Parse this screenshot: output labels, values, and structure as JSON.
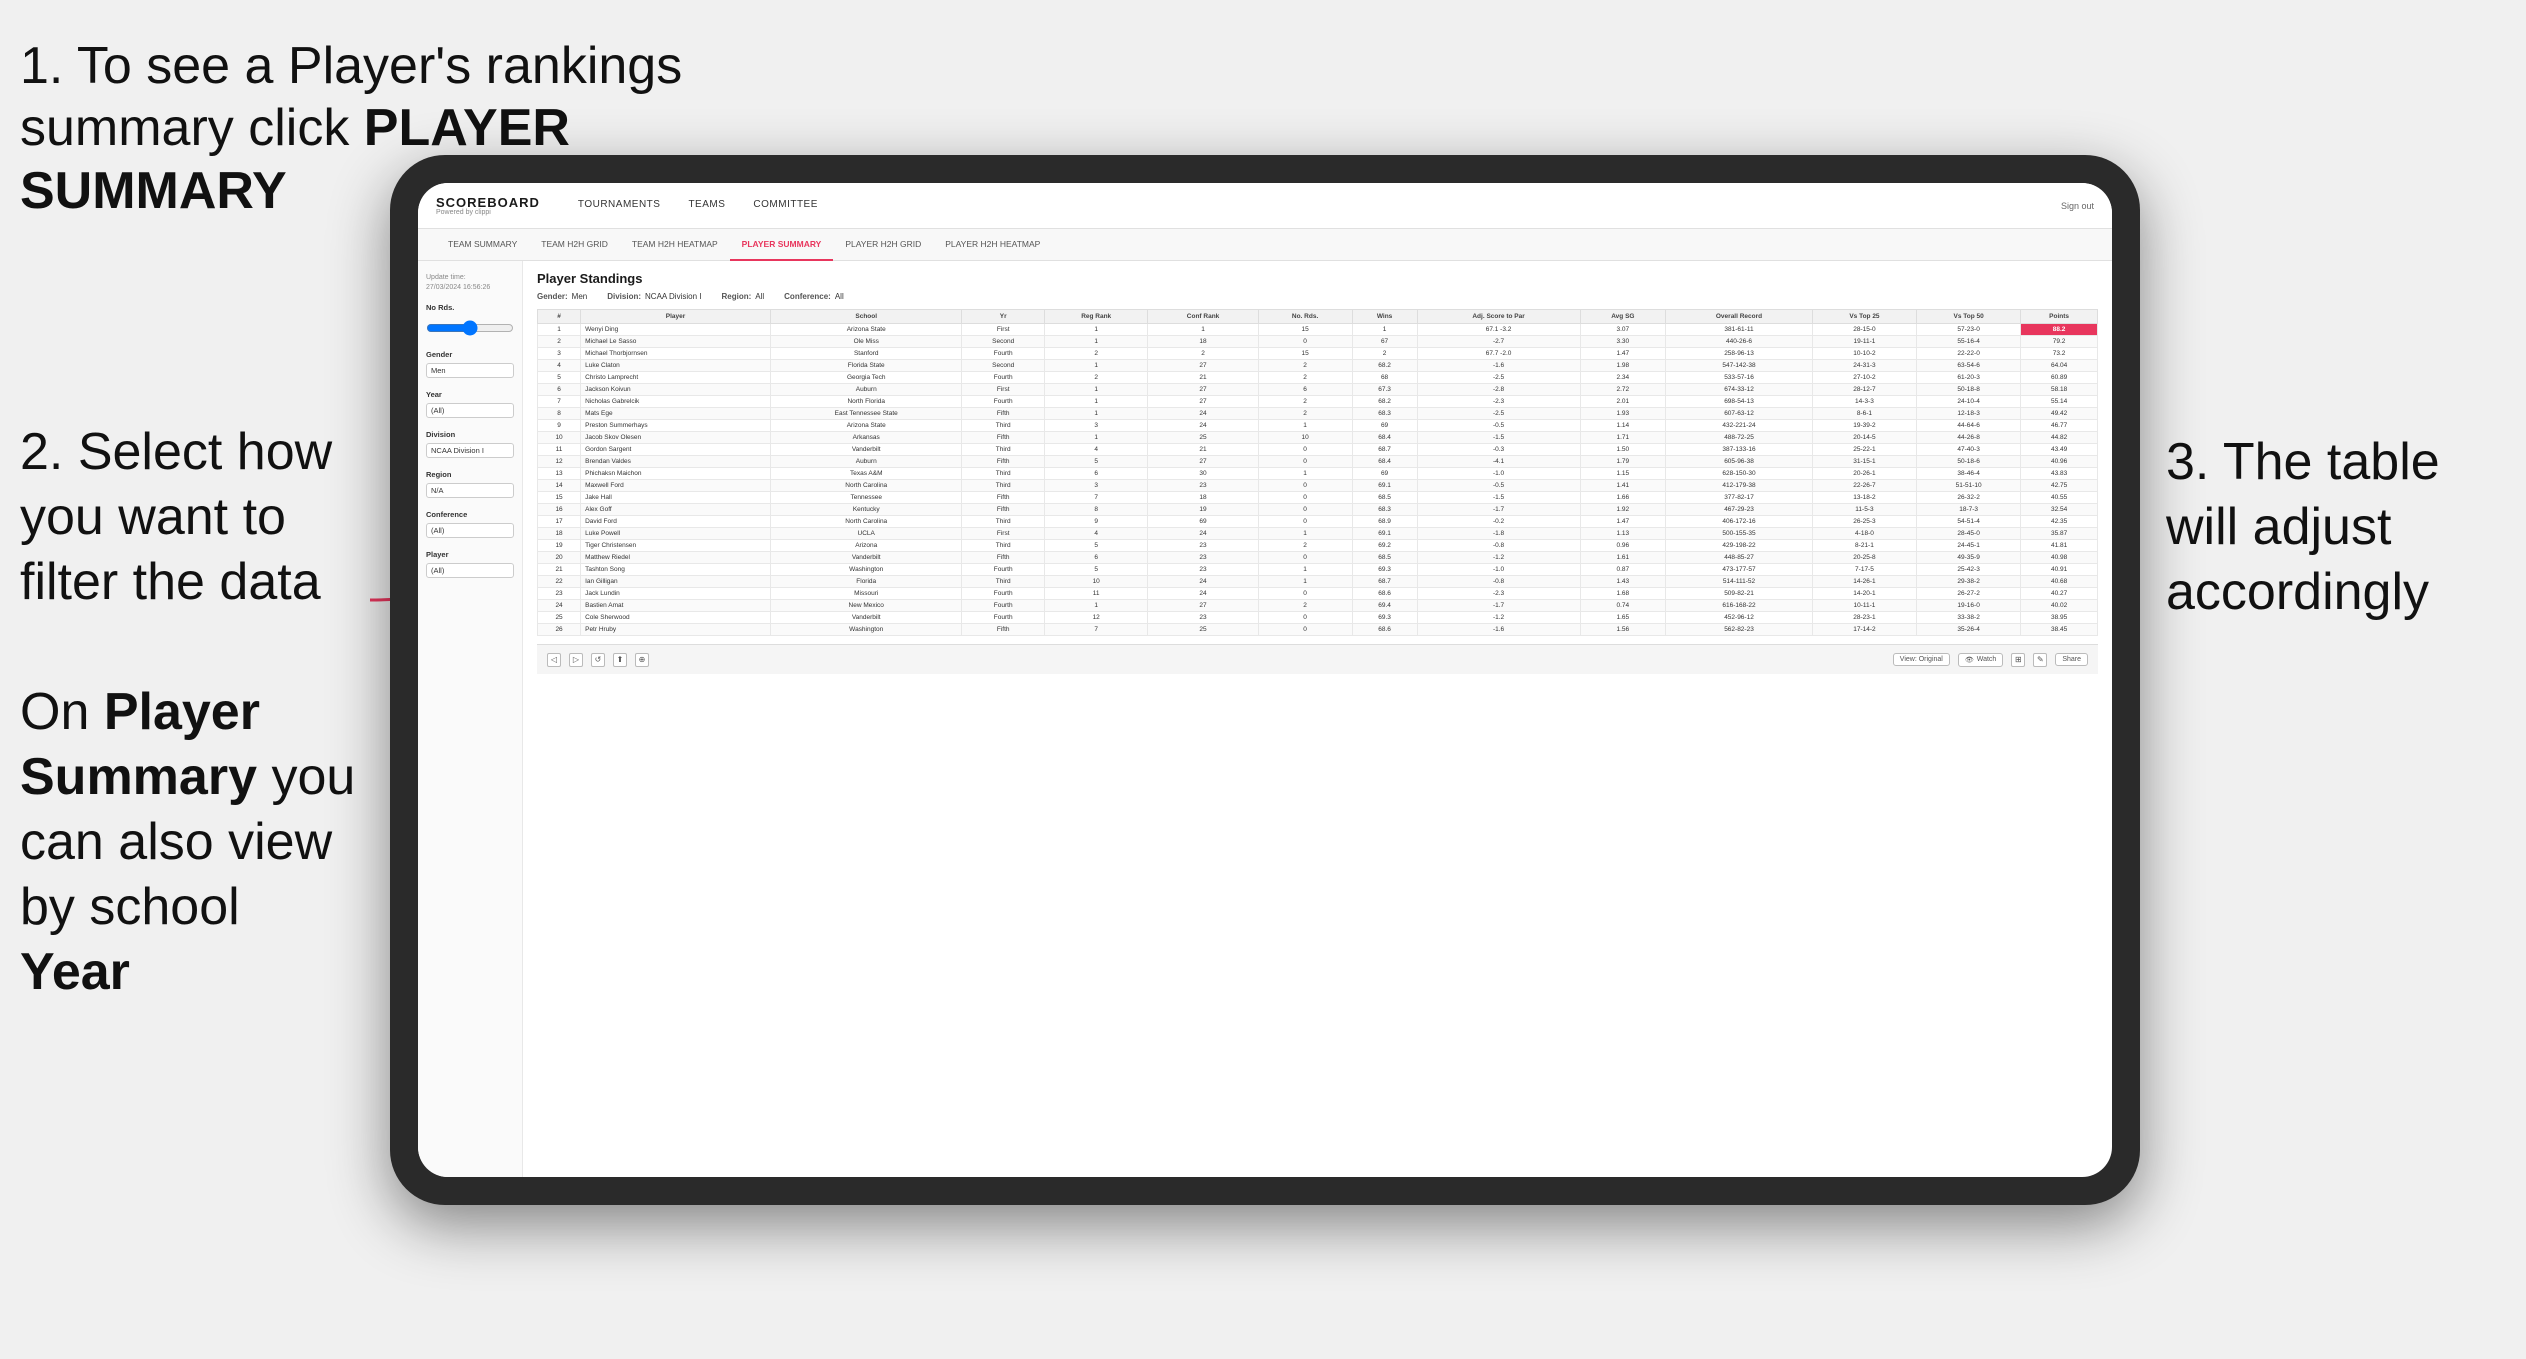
{
  "annotations": {
    "step1_text": "1. To see a Player's rankings summary click ",
    "step1_bold": "PLAYER SUMMARY",
    "step2_text": "2. Select how you want to filter the data",
    "step3_text": "3. The table will adjust accordingly",
    "step4_prefix": "On ",
    "step4_bold1": "Player Summary",
    "step4_middle": " you can also view by school ",
    "step4_bold2": "Year"
  },
  "app": {
    "logo": "SCOREBOARD",
    "logo_sub": "Powered by clippi",
    "sign_out": "Sign out"
  },
  "nav": {
    "items": [
      {
        "label": "TOURNAMENTS",
        "active": false
      },
      {
        "label": "TEAMS",
        "active": false
      },
      {
        "label": "COMMITTEE",
        "active": false
      }
    ]
  },
  "subnav": {
    "items": [
      {
        "label": "TEAM SUMMARY",
        "active": false
      },
      {
        "label": "TEAM H2H GRID",
        "active": false
      },
      {
        "label": "TEAM H2H HEATMAP",
        "active": false
      },
      {
        "label": "PLAYER SUMMARY",
        "active": true
      },
      {
        "label": "PLAYER H2H GRID",
        "active": false
      },
      {
        "label": "PLAYER H2H HEATMAP",
        "active": false
      }
    ]
  },
  "sidebar": {
    "update_label": "Update time:",
    "update_time": "27/03/2024 16:56:26",
    "no_rds_label": "No Rds.",
    "gender_label": "Gender",
    "gender_value": "Men",
    "year_label": "Year",
    "year_value": "(All)",
    "division_label": "Division",
    "division_value": "NCAA Division I",
    "region_label": "Region",
    "region_value": "N/A",
    "conference_label": "Conference",
    "conference_value": "(All)",
    "player_label": "Player",
    "player_value": "(All)"
  },
  "table": {
    "title": "Player Standings",
    "gender_label": "Gender:",
    "gender_value": "Men",
    "division_label": "Division:",
    "division_value": "NCAA Division I",
    "region_label": "Region:",
    "region_value": "All",
    "conference_label": "Conference:",
    "conference_value": "All",
    "columns": [
      "#",
      "Player",
      "School",
      "Yr",
      "Reg Rank",
      "Conf Rank",
      "No. Rds.",
      "Wins",
      "Adj. Score to Par",
      "Avg SG",
      "Overall Record",
      "Vs Top 25",
      "Vs Top 50",
      "Points"
    ],
    "rows": [
      [
        1,
        "Wenyi Ding",
        "Arizona State",
        "First",
        1,
        1,
        15,
        1,
        "67.1 -3.2",
        "3.07",
        "381-61-11",
        "28-15-0",
        "57-23-0",
        "88.2"
      ],
      [
        2,
        "Michael Le Sasso",
        "Ole Miss",
        "Second",
        1,
        18,
        0,
        67,
        "-2.7",
        "3.30",
        "440-26-6",
        "19-11-1",
        "55-16-4",
        "79.2"
      ],
      [
        3,
        "Michael Thorbjornsen",
        "Stanford",
        "Fourth",
        2,
        2,
        15,
        2,
        "67.7 -2.0",
        "1.47",
        "258-96-13",
        "10-10-2",
        "22-22-0",
        "73.2"
      ],
      [
        4,
        "Luke Claton",
        "Florida State",
        "Second",
        1,
        27,
        2,
        68.2,
        "-1.6",
        "1.98",
        "547-142-38",
        "24-31-3",
        "63-54-6",
        "64.04"
      ],
      [
        5,
        "Christo Lamprecht",
        "Georgia Tech",
        "Fourth",
        2,
        21,
        2,
        68.0,
        "-2.5",
        "2.34",
        "533-57-16",
        "27-10-2",
        "61-20-3",
        "60.89"
      ],
      [
        6,
        "Jackson Koivun",
        "Auburn",
        "First",
        1,
        27,
        6,
        67.3,
        "-2.8",
        "2.72",
        "674-33-12",
        "28-12-7",
        "50-18-8",
        "58.18"
      ],
      [
        7,
        "Nicholas Gabrelcik",
        "North Florida",
        "Fourth",
        1,
        27,
        2,
        68.2,
        "-2.3",
        "2.01",
        "698-54-13",
        "14-3-3",
        "24-10-4",
        "55.14"
      ],
      [
        8,
        "Mats Ege",
        "East Tennessee State",
        "Fifth",
        1,
        24,
        2,
        68.3,
        "-2.5",
        "1.93",
        "607-63-12",
        "8-6-1",
        "12-18-3",
        "49.42"
      ],
      [
        9,
        "Preston Summerhays",
        "Arizona State",
        "Third",
        3,
        24,
        1,
        69.0,
        "-0.5",
        "1.14",
        "432-221-24",
        "19-39-2",
        "44-64-6",
        "46.77"
      ],
      [
        10,
        "Jacob Skov Olesen",
        "Arkansas",
        "Fifth",
        1,
        25,
        10,
        68.4,
        "-1.5",
        "1.71",
        "488-72-25",
        "20-14-5",
        "44-26-8",
        "44.82"
      ],
      [
        11,
        "Gordon Sargent",
        "Vanderbilt",
        "Third",
        4,
        21,
        0,
        68.7,
        "-0.3",
        "1.50",
        "387-133-16",
        "25-22-1",
        "47-40-3",
        "43.49"
      ],
      [
        12,
        "Brendan Valdes",
        "Auburn",
        "Fifth",
        5,
        27,
        0,
        68.4,
        "-4.1",
        "1.79",
        "605-96-38",
        "31-15-1",
        "50-18-6",
        "40.96"
      ],
      [
        13,
        "Phichaksn Maichon",
        "Texas A&M",
        "Third",
        6,
        30,
        1,
        69.0,
        "-1.0",
        "1.15",
        "628-150-30",
        "20-26-1",
        "38-46-4",
        "43.83"
      ],
      [
        14,
        "Maxwell Ford",
        "North Carolina",
        "Third",
        3,
        23,
        0,
        69.1,
        "-0.5",
        "1.41",
        "412-179-38",
        "22-26-7",
        "51-51-10",
        "42.75"
      ],
      [
        15,
        "Jake Hall",
        "Tennessee",
        "Fifth",
        7,
        18,
        0,
        68.5,
        "-1.5",
        "1.66",
        "377-82-17",
        "13-18-2",
        "26-32-2",
        "40.55"
      ],
      [
        16,
        "Alex Goff",
        "Kentucky",
        "Fifth",
        8,
        19,
        0,
        68.3,
        "-1.7",
        "1.92",
        "467-29-23",
        "11-5-3",
        "18-7-3",
        "32.54"
      ],
      [
        17,
        "David Ford",
        "North Carolina",
        "Third",
        9,
        69,
        0,
        68.9,
        "-0.2",
        "1.47",
        "406-172-16",
        "26-25-3",
        "54-51-4",
        "42.35"
      ],
      [
        18,
        "Luke Powell",
        "UCLA",
        "First",
        4,
        24,
        1,
        69.1,
        "-1.8",
        "1.13",
        "500-155-35",
        "4-18-0",
        "28-45-0",
        "35.87"
      ],
      [
        19,
        "Tiger Christensen",
        "Arizona",
        "Third",
        5,
        23,
        2,
        69.2,
        "-0.8",
        "0.96",
        "429-198-22",
        "8-21-1",
        "24-45-1",
        "41.81"
      ],
      [
        20,
        "Matthew Riedel",
        "Vanderbilt",
        "Fifth",
        6,
        23,
        0,
        68.5,
        "-1.2",
        "1.61",
        "448-85-27",
        "20-25-8",
        "49-35-9",
        "40.98"
      ],
      [
        21,
        "Tashton Song",
        "Washington",
        "Fourth",
        5,
        23,
        1,
        69.3,
        "-1.0",
        "0.87",
        "473-177-57",
        "7-17-5",
        "25-42-3",
        "40.91"
      ],
      [
        22,
        "Ian Gilligan",
        "Florida",
        "Third",
        10,
        24,
        1,
        68.7,
        "-0.8",
        "1.43",
        "514-111-52",
        "14-26-1",
        "29-38-2",
        "40.68"
      ],
      [
        23,
        "Jack Lundin",
        "Missouri",
        "Fourth",
        11,
        24,
        0,
        68.6,
        "-2.3",
        "1.68",
        "509-82-21",
        "14-20-1",
        "26-27-2",
        "40.27"
      ],
      [
        24,
        "Bastien Amat",
        "New Mexico",
        "Fourth",
        1,
        27,
        2,
        69.4,
        "-1.7",
        "0.74",
        "616-168-22",
        "10-11-1",
        "19-16-0",
        "40.02"
      ],
      [
        25,
        "Cole Sherwood",
        "Vanderbilt",
        "Fourth",
        12,
        23,
        0,
        69.3,
        "-1.2",
        "1.65",
        "452-96-12",
        "28-23-1",
        "33-38-2",
        "38.95"
      ],
      [
        26,
        "Petr Hruby",
        "Washington",
        "Fifth",
        7,
        25,
        0,
        68.6,
        "-1.6",
        "1.56",
        "562-82-23",
        "17-14-2",
        "35-26-4",
        "38.45"
      ]
    ]
  },
  "toolbar": {
    "view_label": "View: Original",
    "watch_label": "Watch",
    "share_label": "Share"
  }
}
